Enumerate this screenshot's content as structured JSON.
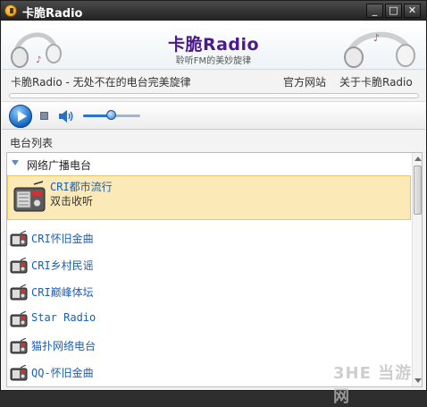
{
  "window": {
    "title": "卡脆Radio",
    "min": "_",
    "max": "□",
    "close": "✕"
  },
  "banner": {
    "logo": "卡脆Radio",
    "tagline": "聆听FM的美妙旋律"
  },
  "infobar": {
    "slogan": "卡脆Radio - 无处不在的电台完美旋律",
    "official_site": "官方网站",
    "about": "关于卡脆Radio"
  },
  "player": {
    "volume_level": 0.48
  },
  "list": {
    "title": "电台列表",
    "group": "网络广播电台",
    "selected": {
      "name": "CRI都市流行",
      "hint": "双击收听"
    },
    "stations": [
      "CRI怀旧金曲",
      "CRI乡村民谣",
      "CRI巅峰体坛",
      "Star Radio",
      "猫扑网络电台",
      "QQ-怀旧金曲"
    ]
  },
  "watermark": "3HE 当游网",
  "icons": [
    "app-icon",
    "headphones-icon",
    "play-icon",
    "stop-icon",
    "speaker-icon",
    "radio-icon"
  ]
}
